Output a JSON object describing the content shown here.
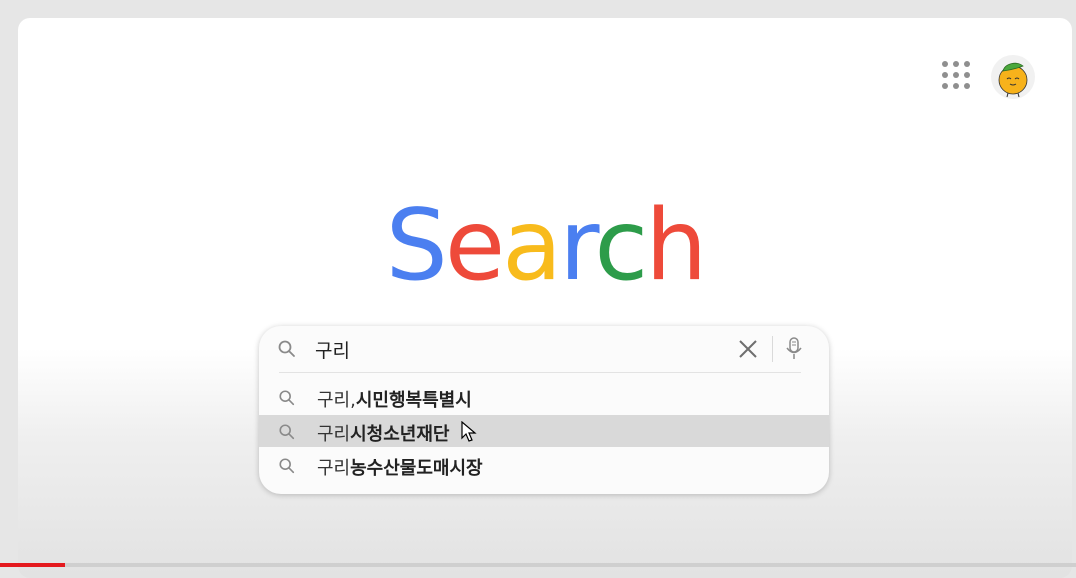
{
  "header": {
    "apps_icon": "apps-grid-icon",
    "avatar_icon": "avatar-character-icon"
  },
  "logo": {
    "letters": [
      {
        "char": "S",
        "color": "#4b7ff0"
      },
      {
        "char": "e",
        "color": "#ee4a3a"
      },
      {
        "char": "a",
        "color": "#f8bb1c"
      },
      {
        "char": "r",
        "color": "#4b7ff0"
      },
      {
        "char": "c",
        "color": "#2d9c4a"
      },
      {
        "char": "h",
        "color": "#ee4a3a"
      }
    ]
  },
  "search": {
    "value": "구리",
    "search_icon": "search-icon",
    "clear_icon": "close-icon",
    "mic_icon": "microphone-icon"
  },
  "suggestions": [
    {
      "prefix": "구리,",
      "bold": "시민행복특별시",
      "highlighted": false
    },
    {
      "prefix": "구리",
      "bold": "시청소년재단",
      "highlighted": true
    },
    {
      "prefix": "구리",
      "bold": "농수산물도매시장",
      "highlighted": false
    }
  ],
  "video_progress": {
    "fraction": 0.06,
    "color": "#e4191e"
  }
}
